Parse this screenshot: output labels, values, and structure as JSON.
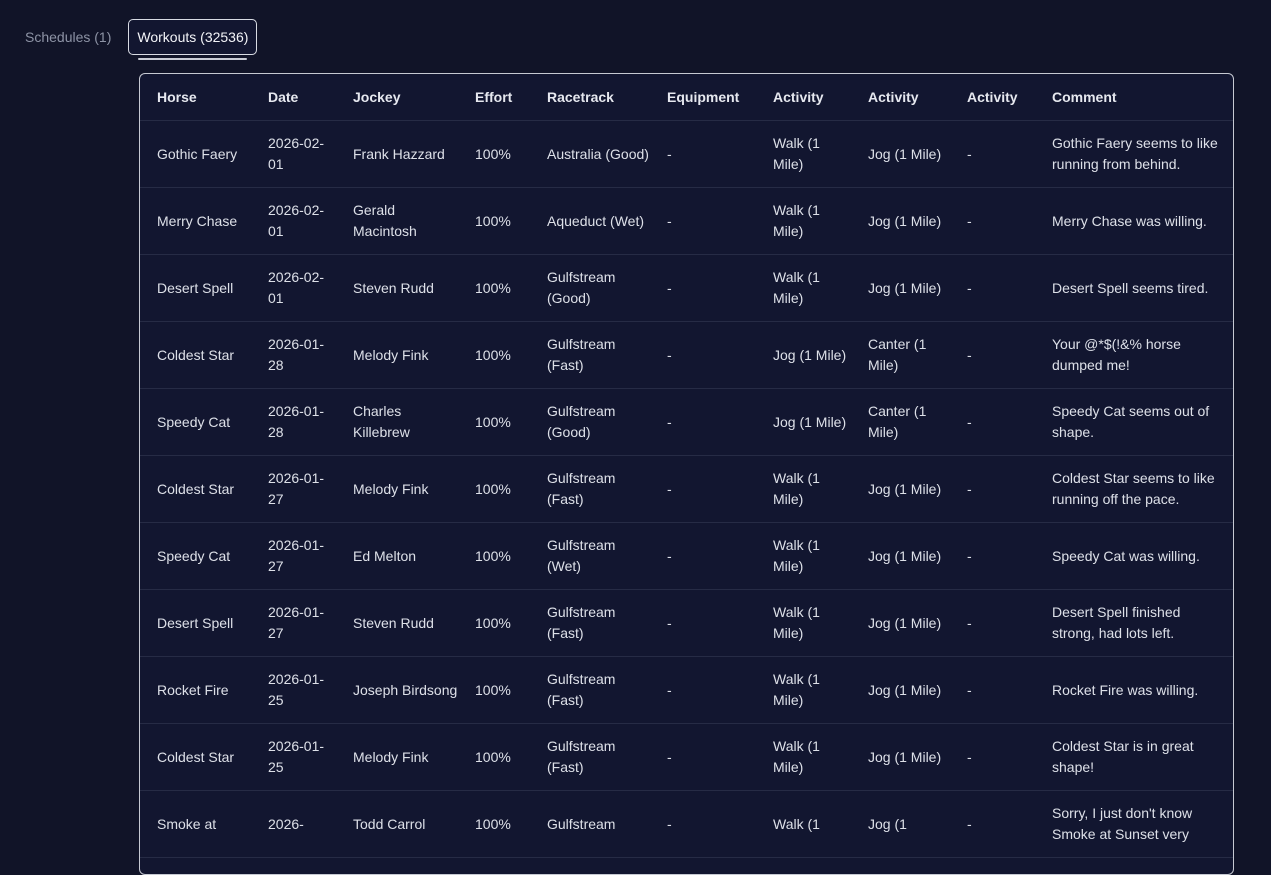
{
  "tabs": [
    {
      "label": "Schedules (1)",
      "active": false
    },
    {
      "label": "Workouts (32536)",
      "active": true
    }
  ],
  "table": {
    "headers": [
      "Horse",
      "Date",
      "Jockey",
      "Effort",
      "Racetrack",
      "Equipment",
      "Activity",
      "Activity",
      "Activity",
      "Comment"
    ],
    "rows": [
      [
        "Gothic Faery",
        "2026-02-01",
        "Frank Hazzard",
        "100%",
        "Australia (Good)",
        "-",
        "Walk (1 Mile)",
        "Jog (1 Mile)",
        "-",
        "Gothic Faery seems to like running from behind."
      ],
      [
        "Merry Chase",
        "2026-02-01",
        "Gerald Macintosh",
        "100%",
        "Aqueduct (Wet)",
        "-",
        "Walk (1 Mile)",
        "Jog (1 Mile)",
        "-",
        "Merry Chase was willing."
      ],
      [
        "Desert Spell",
        "2026-02-01",
        "Steven Rudd",
        "100%",
        "Gulfstream (Good)",
        "-",
        "Walk (1 Mile)",
        "Jog (1 Mile)",
        "-",
        "Desert Spell seems tired."
      ],
      [
        "Coldest Star",
        "2026-01-28",
        "Melody Fink",
        "100%",
        "Gulfstream (Fast)",
        "-",
        "Jog (1 Mile)",
        "Canter (1 Mile)",
        "-",
        "Your @*$(!&% horse dumped me!"
      ],
      [
        "Speedy Cat",
        "2026-01-28",
        "Charles Killebrew",
        "100%",
        "Gulfstream (Good)",
        "-",
        "Jog (1 Mile)",
        "Canter (1 Mile)",
        "-",
        "Speedy Cat seems out of shape."
      ],
      [
        "Coldest Star",
        "2026-01-27",
        "Melody Fink",
        "100%",
        "Gulfstream (Fast)",
        "-",
        "Walk (1 Mile)",
        "Jog (1 Mile)",
        "-",
        "Coldest Star seems to like running off the pace."
      ],
      [
        "Speedy Cat",
        "2026-01-27",
        "Ed Melton",
        "100%",
        "Gulfstream (Wet)",
        "-",
        "Walk (1 Mile)",
        "Jog (1 Mile)",
        "-",
        "Speedy Cat was willing."
      ],
      [
        "Desert Spell",
        "2026-01-27",
        "Steven Rudd",
        "100%",
        "Gulfstream (Fast)",
        "-",
        "Walk (1 Mile)",
        "Jog (1 Mile)",
        "-",
        "Desert Spell finished strong, had lots left."
      ],
      [
        "Rocket Fire",
        "2026-01-25",
        "Joseph Birdsong",
        "100%",
        "Gulfstream (Fast)",
        "-",
        "Walk (1 Mile)",
        "Jog (1 Mile)",
        "-",
        "Rocket Fire was willing."
      ],
      [
        "Coldest Star",
        "2026-01-25",
        "Melody Fink",
        "100%",
        "Gulfstream (Fast)",
        "-",
        "Walk (1 Mile)",
        "Jog (1 Mile)",
        "-",
        "Coldest Star is in great shape!"
      ],
      [
        "Smoke at",
        "2026-",
        "Todd Carrol",
        "100%",
        "Gulfstream",
        "-",
        "Walk (1",
        "Jog (1",
        "-",
        "Sorry, I just don't know Smoke at Sunset very"
      ]
    ]
  }
}
